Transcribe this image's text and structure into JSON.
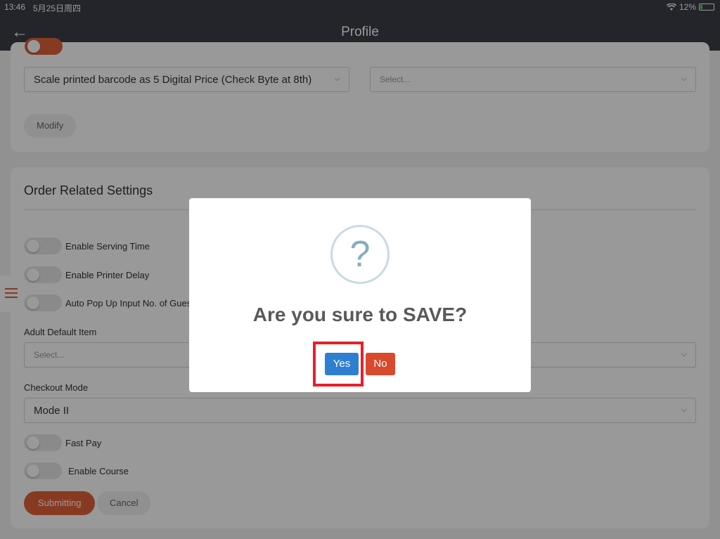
{
  "status_bar": {
    "time": "13:46",
    "date": "5月25日周四",
    "battery": "12%"
  },
  "header": {
    "back_icon": "←",
    "title": "Profile"
  },
  "barcode_card": {
    "barcode_select": "Scale printed barcode as 5 Digital Price (Check Byte at 8th)",
    "second_select_placeholder": "Select...",
    "modify_label": "Modify"
  },
  "order_settings": {
    "title": "Order Related Settings",
    "toggles": [
      {
        "label": "Enable Serving Time"
      },
      {
        "label": "Enable Printer Delay"
      },
      {
        "label": "Auto Pop Up Input No. of Guests"
      }
    ],
    "adult_default_item_label": "Adult Default Item",
    "adult_default_item_placeholder": "Select...",
    "checkout_mode_label": "Checkout Mode",
    "checkout_mode_value": "Mode II",
    "fast_pay_label": "Fast Pay",
    "enable_course_label": "Enable Course",
    "submit_label": "Submitting",
    "cancel_label": "Cancel"
  },
  "dialog": {
    "icon": "?",
    "message": "Are you sure to SAVE?",
    "yes_label": "Yes",
    "no_label": "No"
  },
  "colors": {
    "header": "#3b3e46",
    "accent": "#e1623a",
    "yes": "#2f7fd1",
    "no": "#d9492e",
    "highlight": "#e8202a"
  }
}
